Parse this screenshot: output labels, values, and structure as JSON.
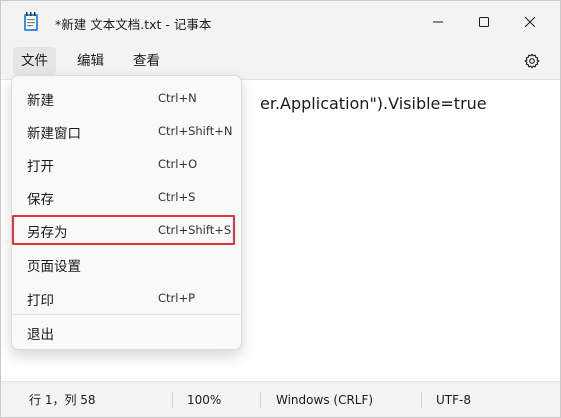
{
  "window": {
    "title": "*新建 文本文档.txt - 记事本"
  },
  "menubar": {
    "file": "文件",
    "edit": "编辑",
    "view": "查看"
  },
  "editor": {
    "visible_text": "er.Application\").Visible=true"
  },
  "file_menu": {
    "items": [
      {
        "label": "新建",
        "shortcut": "Ctrl+N"
      },
      {
        "label": "新建窗口",
        "shortcut": "Ctrl+Shift+N"
      },
      {
        "label": "打开",
        "shortcut": "Ctrl+O"
      },
      {
        "label": "保存",
        "shortcut": "Ctrl+S"
      },
      {
        "label": "另存为",
        "shortcut": "Ctrl+Shift+S"
      },
      {
        "label": "页面设置",
        "shortcut": ""
      },
      {
        "label": "打印",
        "shortcut": "Ctrl+P"
      },
      {
        "label": "退出",
        "shortcut": ""
      }
    ],
    "highlighted_item": "另存为",
    "highlight_color": "#e0343d"
  },
  "statusbar": {
    "position": "行 1，列 58",
    "zoom": "100%",
    "line_ending": "Windows (CRLF)",
    "encoding": "UTF-8"
  },
  "icons": {
    "app": "notepad-icon",
    "minimize": "minimize-icon",
    "maximize": "maximize-icon",
    "close": "close-icon",
    "settings": "gear-icon"
  }
}
